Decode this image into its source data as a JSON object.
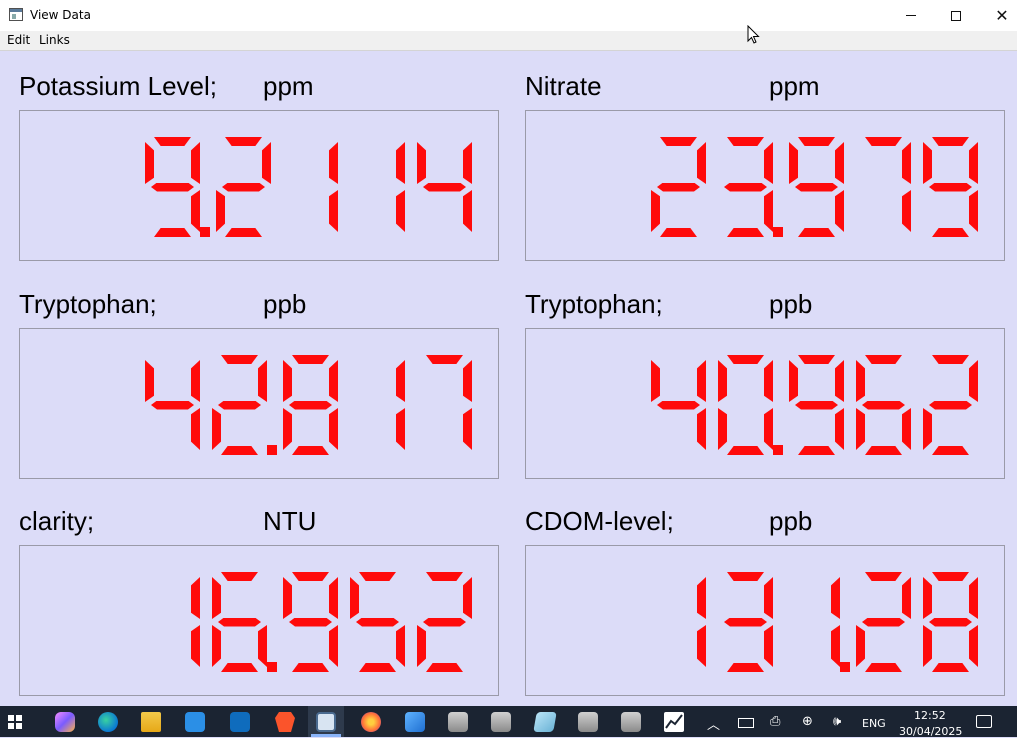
{
  "window": {
    "title": "View Data",
    "icon": "window-app-icon",
    "controls": {
      "minimize": "minimize-icon",
      "maximize": "maximize-icon",
      "close": "close-icon"
    }
  },
  "menu": {
    "edit": "Edit",
    "links": "Links"
  },
  "panels": [
    {
      "name": "Potassium Level;",
      "unit": "ppm",
      "value": "9.2114"
    },
    {
      "name": "Nitrate",
      "unit": "ppm",
      "value": "23.979"
    },
    {
      "name": "Tryptophan;",
      "unit": "ppb",
      "value": "42.817"
    },
    {
      "name": "Tryptophan;",
      "unit": "ppb",
      "value": "40.962"
    },
    {
      "name": "clarity;",
      "unit": "NTU",
      "value": "16.952"
    },
    {
      "name": "CDOM-level;",
      "unit": "ppb",
      "value": "131.28"
    }
  ],
  "colors": {
    "display_digit": "#ff0b0b",
    "background": "#dcdcf8",
    "taskbar": "#1b2432"
  },
  "taskbar": {
    "apps": [
      "windows-start-icon",
      "copilot-icon",
      "edge-icon",
      "file-explorer-icon",
      "store-icon",
      "outlook-icon",
      "brave-icon",
      "view-data-app-icon",
      "firefox-icon",
      "photos-icon",
      "network-drive-icon",
      "network-drive-icon",
      "notepad-icon",
      "network-drive-icon",
      "network-drive-icon",
      "chart-app-icon"
    ],
    "language": "ENG",
    "time": "12:52",
    "date": "30/04/2025"
  }
}
